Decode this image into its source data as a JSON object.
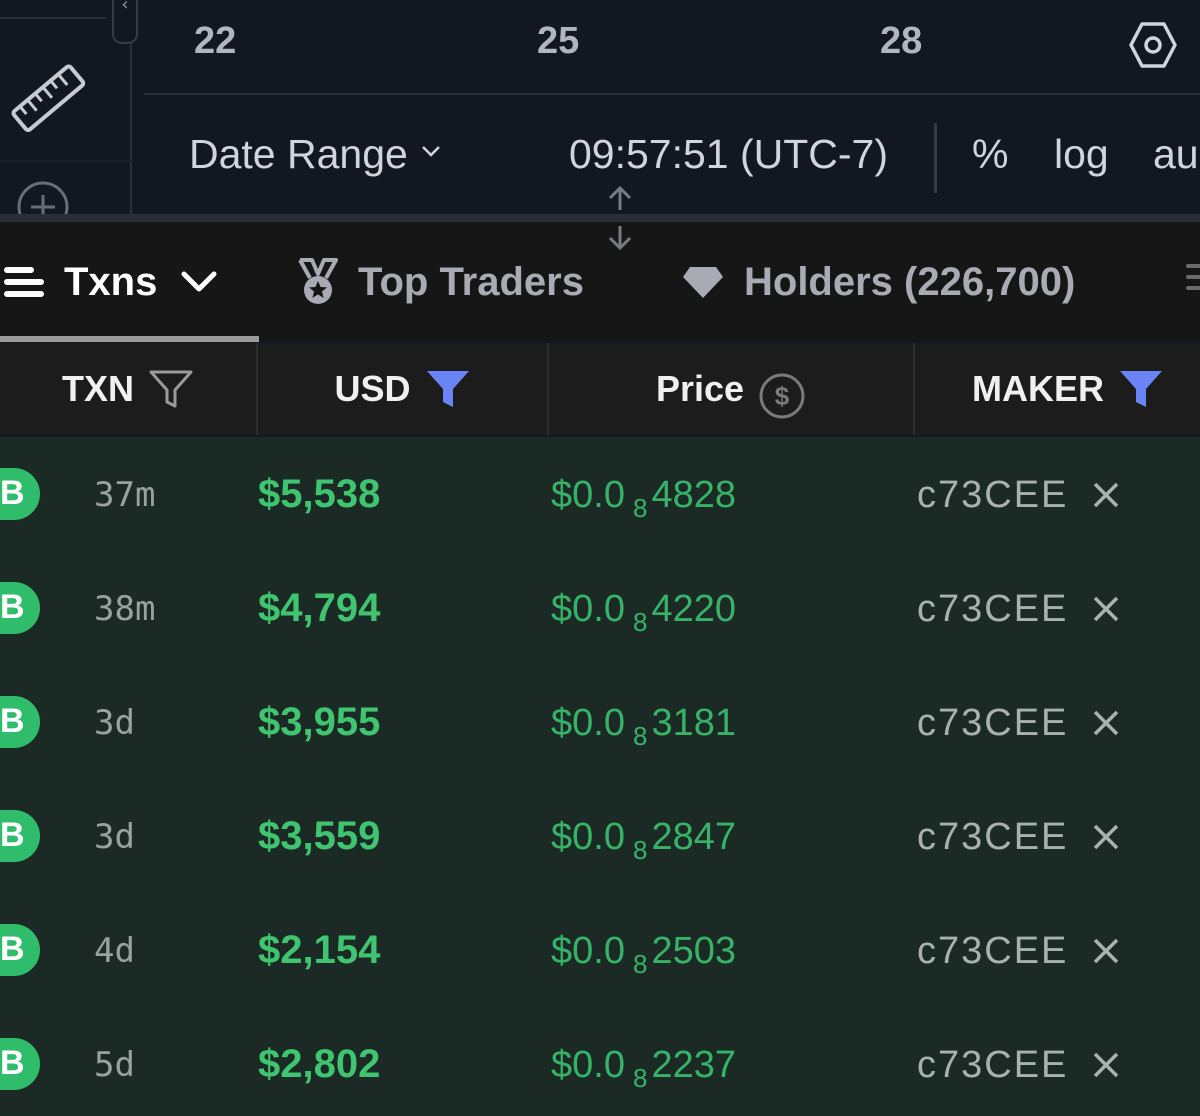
{
  "chart": {
    "axis_ticks": [
      "22",
      "25",
      "28"
    ],
    "date_range_label": "Date Range",
    "clock": "09:57:51 (UTC-7)",
    "percent_label": "%",
    "log_label": "log",
    "auto_label": "au"
  },
  "tabs": [
    {
      "label": "Txns",
      "icon": "list-icon"
    },
    {
      "label": "Top Traders",
      "icon": "medal-icon"
    },
    {
      "label": "Holders (226,700)",
      "icon": "diamond-icon"
    }
  ],
  "table": {
    "columns": [
      "TXN",
      "USD",
      "Price",
      "MAKER"
    ],
    "rows": [
      {
        "type": "B",
        "age": "37m",
        "usd": "$5,538",
        "price_prefix": "$0.0",
        "price_zeros": "8",
        "price_digits": "4828",
        "maker": "c73CEE"
      },
      {
        "type": "B",
        "age": "38m",
        "usd": "$4,794",
        "price_prefix": "$0.0",
        "price_zeros": "8",
        "price_digits": "4220",
        "maker": "c73CEE"
      },
      {
        "type": "B",
        "age": "3d",
        "usd": "$3,955",
        "price_prefix": "$0.0",
        "price_zeros": "8",
        "price_digits": "3181",
        "maker": "c73CEE"
      },
      {
        "type": "B",
        "age": "3d",
        "usd": "$3,559",
        "price_prefix": "$0.0",
        "price_zeros": "8",
        "price_digits": "2847",
        "maker": "c73CEE"
      },
      {
        "type": "B",
        "age": "4d",
        "usd": "$2,154",
        "price_prefix": "$0.0",
        "price_zeros": "8",
        "price_digits": "2503",
        "maker": "c73CEE"
      },
      {
        "type": "B",
        "age": "5d",
        "usd": "$2,802",
        "price_prefix": "$0.0",
        "price_zeros": "8",
        "price_digits": "2237",
        "maker": "c73CEE"
      }
    ]
  },
  "colors": {
    "buy_green": "#2fbd6b",
    "usd_green": "#3fc46f",
    "filter_active_blue": "#6b84f5",
    "chart_bg": "#131722",
    "table_bg": "#1c2a26"
  }
}
